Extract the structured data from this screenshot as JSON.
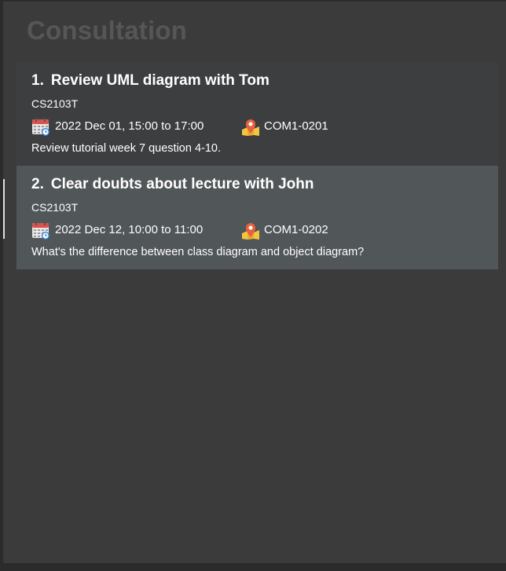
{
  "panel": {
    "title": "Consultation"
  },
  "consultations": [
    {
      "index": "1.",
      "name": "Review UML diagram with Tom",
      "module": "CS2103T",
      "time": "2022 Dec 01, 15:00 to 17:00",
      "location": "COM1-0201",
      "description": "Review tutorial week 7 question 4-10."
    },
    {
      "index": "2.",
      "name": "Clear doubts about lecture with John",
      "module": "CS2103T",
      "time": "2022 Dec 12, 10:00 to 11:00",
      "location": "COM1-0202",
      "description": "What's the difference between class diagram and object diagram?"
    }
  ],
  "icons": {
    "calendar": "calendar-icon",
    "location": "location-pin-icon"
  },
  "colors": {
    "background": "#3b3b3b",
    "card_odd": "#3c3e3f",
    "card_even": "#515658",
    "title_text": "#555757",
    "text": "#ffffff"
  }
}
